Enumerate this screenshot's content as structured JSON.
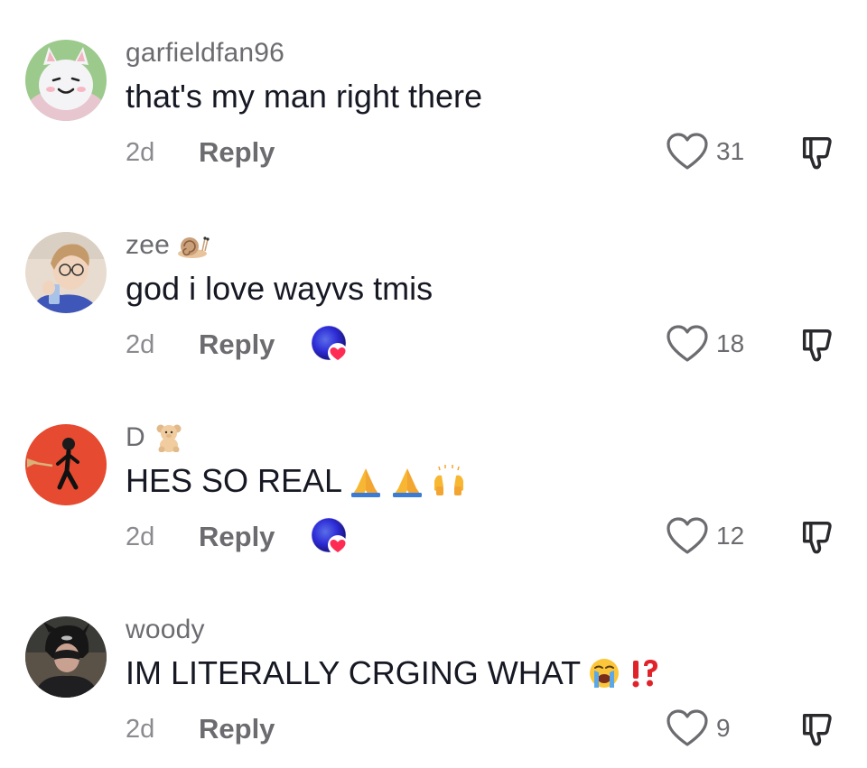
{
  "comments": [
    {
      "username": "garfieldfan96",
      "username_emoji": "",
      "text": "that's my man right there",
      "text_emojis": [],
      "time": "2d",
      "reply_label": "Reply",
      "liked_by_creator": false,
      "likes": "31",
      "avatar": "cartoon-cat-avatar"
    },
    {
      "username": "zee",
      "username_emoji": "snail-emoji",
      "text": "god i love wayvs tmis",
      "text_emojis": [],
      "time": "2d",
      "reply_label": "Reply",
      "liked_by_creator": true,
      "likes": "18",
      "avatar": "person-selfie-avatar"
    },
    {
      "username": "D",
      "username_emoji": "teddy-bear-emoji",
      "text": "HES SO REAL",
      "text_emojis": [
        "folded-hands-emoji",
        "folded-hands-emoji",
        "raising-hands-emoji"
      ],
      "time": "2d",
      "reply_label": "Reply",
      "liked_by_creator": true,
      "likes": "12",
      "avatar": "walking-figure-avatar"
    },
    {
      "username": "woody",
      "username_emoji": "",
      "text": "IM LITERALLY CRGING WHAT",
      "text_emojis": [
        "loudly-crying-face-emoji",
        "exclamation-question-mark-emoji"
      ],
      "time": "2d",
      "reply_label": "Reply",
      "liked_by_creator": false,
      "likes": "9",
      "avatar": "person-hat-avatar"
    }
  ],
  "colors": {
    "text_primary": "#161823",
    "text_secondary": "#6b6b70",
    "heart_red": "#fe2c55",
    "badge_blue": "#2d2bd6"
  }
}
